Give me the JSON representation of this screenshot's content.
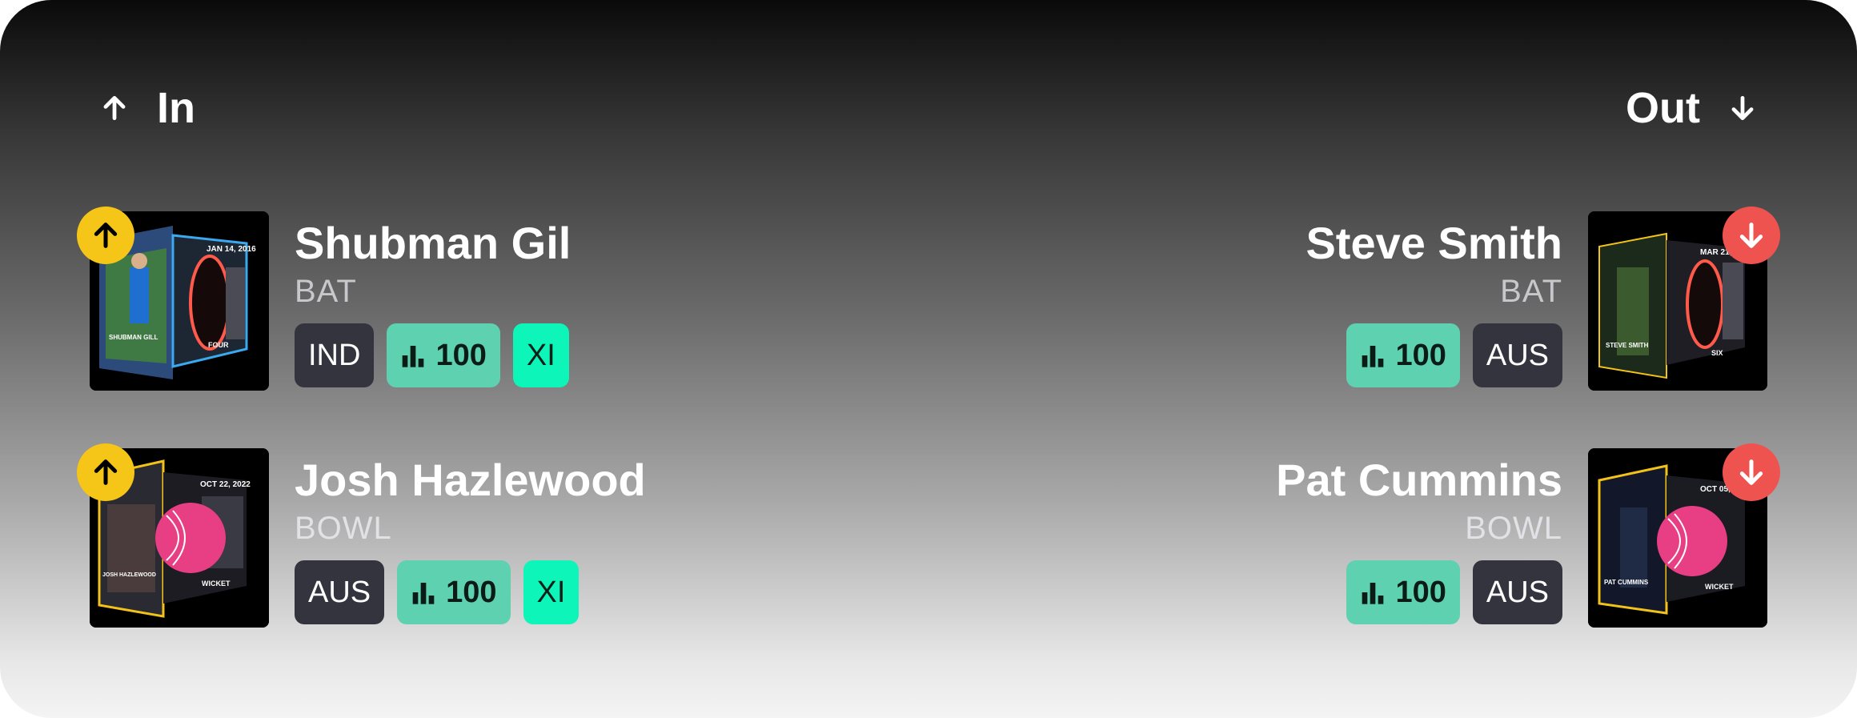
{
  "header": {
    "in_label": "In",
    "out_label": "Out"
  },
  "in_players": [
    {
      "name": "Shubman Gil",
      "role": "BAT",
      "team": "IND",
      "score": "100",
      "status": "XI",
      "card": {
        "date": "JAN 14, 2016",
        "caption": "SHUBMAN GILL",
        "event": "FOUR"
      }
    },
    {
      "name": "Josh Hazlewood",
      "role": "BOWL",
      "team": "AUS",
      "score": "100",
      "status": "XI",
      "card": {
        "date": "OCT 22, 2022",
        "caption": "JOSH HAZLEWOOD",
        "event": "WICKET"
      }
    }
  ],
  "out_players": [
    {
      "name": "Steve Smith",
      "role": "BAT",
      "team": "AUS",
      "score": "100",
      "card": {
        "date": "MAR 21, 2016",
        "caption": "STEVE SMITH",
        "event": "SIX"
      }
    },
    {
      "name": "Pat Cummins",
      "role": "BOWL",
      "team": "AUS",
      "score": "100",
      "card": {
        "date": "OCT 05, 2022",
        "caption": "PAT CUMMINS",
        "event": "WICKET"
      }
    }
  ],
  "icons": {
    "in": "arrow-up-icon",
    "out": "arrow-down-icon",
    "score": "bar-chart-icon"
  },
  "colors": {
    "in_badge": "#f5c518",
    "out_badge": "#ef5350",
    "score_chip": "#5ed1b0",
    "xi_chip": "#0df5b8",
    "team_chip": "#34343f"
  }
}
